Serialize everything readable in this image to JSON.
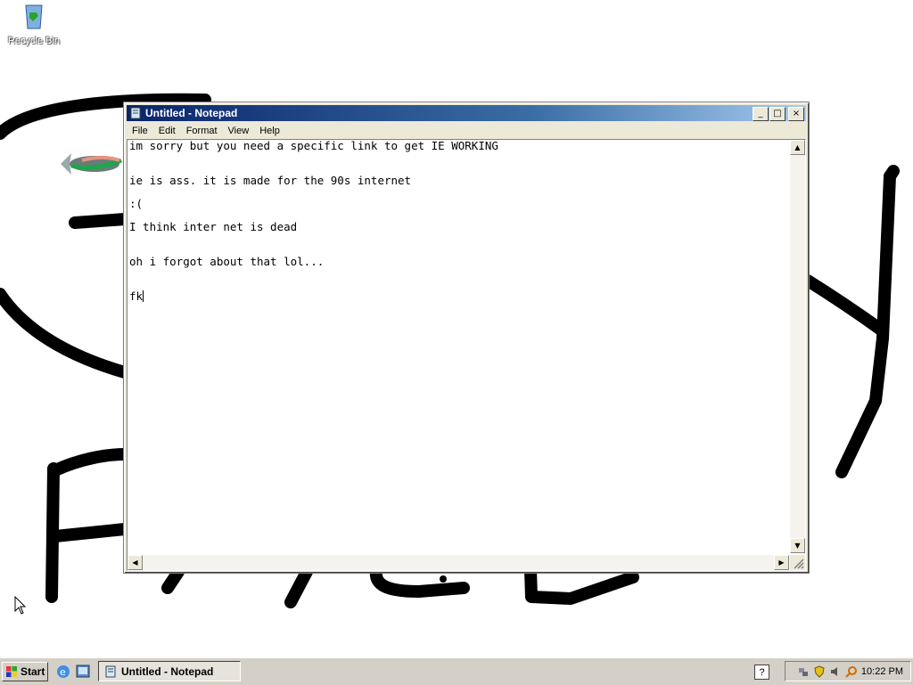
{
  "desktop": {
    "icons": [
      {
        "label": "Recycle Bin",
        "icon": "recycle-bin-icon"
      }
    ]
  },
  "notepad": {
    "title": "Untitled - Notepad",
    "menu": [
      "File",
      "Edit",
      "Format",
      "View",
      "Help"
    ],
    "lines": [
      "im sorry but you need a specific link to get IE WORKING",
      "",
      "",
      "ie is ass. it is made for the 90s internet",
      "",
      ":(",
      "",
      "I think inter net is dead",
      "",
      "",
      "oh i forgot about that lol...",
      "",
      "",
      "fk"
    ],
    "controls": {
      "minimize": "_",
      "maximize": "□",
      "close": "×"
    }
  },
  "taskbar": {
    "start_label": "Start",
    "task_label": "Untitled - Notepad",
    "clock": "10:22 PM",
    "help": "?"
  },
  "colors": {
    "title_gradient_start": "#0a246a",
    "title_gradient_end": "#a6caf0",
    "chrome": "#ece9d8"
  }
}
